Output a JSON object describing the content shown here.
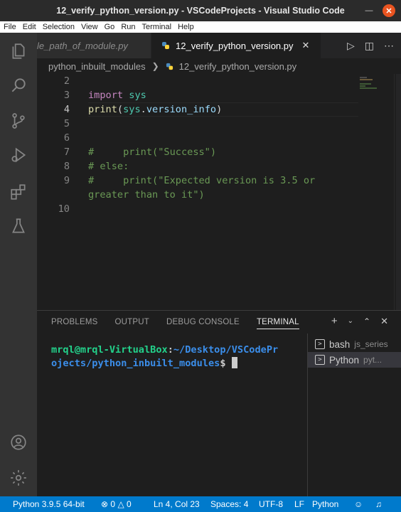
{
  "window": {
    "title": "12_verify_python_version.py - VSCodeProjects - Visual Studio Code"
  },
  "menu": [
    "File",
    "Edit",
    "Selection",
    "View",
    "Go",
    "Run",
    "Terminal",
    "Help"
  ],
  "tabs": {
    "inactive_label": "le_path_of_module.py",
    "active_label": "12_verify_python_version.py"
  },
  "breadcrumb": {
    "folder": "python_inbuilt_modules",
    "file": "12_verify_python_version.py"
  },
  "editor": {
    "line_numbers": [
      "2",
      "3",
      "4",
      "5",
      "6",
      "7",
      "8",
      "9",
      "10"
    ],
    "l3": {
      "kw": "import",
      "mod": "sys"
    },
    "l4": {
      "fn": "print",
      "p1": "(",
      "mod": "sys",
      "dot": ".",
      "attr": "version_info",
      "p2": ")"
    },
    "l7": "#     print(\"Success\")",
    "l8": "# else:",
    "l9a": "#     print(\"Expected version is 3.5 or",
    "l9b": "greater than to it\")"
  },
  "panel": {
    "tabs": [
      "PROBLEMS",
      "OUTPUT",
      "DEBUG CONSOLE",
      "TERMINAL"
    ],
    "active_tab": "TERMINAL"
  },
  "terminal": {
    "user": "mrql@mrql-VirtualBox",
    "colon": ":",
    "path1": "~/Desktop/VSCodePr",
    "path2": "ojects/python_inbuilt_modules",
    "prompt": "$"
  },
  "terminal_list": [
    {
      "name": "bash",
      "desc": "js_series"
    },
    {
      "name": "Python",
      "desc": "pyt..."
    }
  ],
  "status": {
    "interpreter": "Python 3.9.5 64-bit",
    "errors": "0",
    "warnings": "0",
    "position": "Ln 4, Col 23",
    "spaces": "Spaces: 4",
    "encoding": "UTF-8",
    "eol": "LF",
    "language": "Python"
  }
}
